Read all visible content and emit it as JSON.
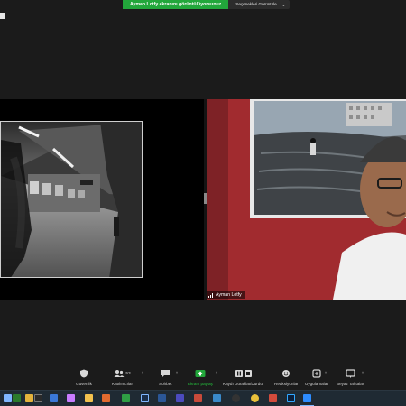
{
  "banner": {
    "share_text": "Ayman Lotfy ekranını görüntülüyorsunuz",
    "view_options_label": "Seçenekleri Görüntüle",
    "caret": "⌄"
  },
  "participant": {
    "name": "Ayman Lotfy"
  },
  "toolbar": {
    "items": [
      {
        "name": "security",
        "label": "Güvenlik",
        "icon": "shield-icon"
      },
      {
        "name": "participants",
        "label": "Katılımcılar",
        "icon": "participants-icon",
        "count": "53"
      },
      {
        "name": "chat",
        "label": "Sohbet",
        "icon": "chat-icon"
      },
      {
        "name": "share-screen",
        "label": "Ekranı paylaş",
        "icon": "share-screen-icon"
      },
      {
        "name": "record",
        "label": "Kaydı Duraklat/Durdur",
        "icon": "pause-stop-icon"
      },
      {
        "name": "reactions",
        "label": "Reaksiyonlar",
        "icon": "reaction-icon"
      },
      {
        "name": "apps",
        "label": "Uygulamalar",
        "icon": "apps-icon"
      },
      {
        "name": "whiteboard",
        "label": "Beyaz Tahtalar",
        "icon": "whiteboard-icon"
      }
    ],
    "chevron": "^"
  },
  "taskbar": {
    "apps": [
      "start-icon",
      "task-view-icon",
      "explorer-icon",
      "terminal-icon",
      "mail-icon",
      "folder-icon",
      "browser-icon",
      "notes-icon",
      "powerpoint-icon",
      "excel-icon",
      "lightroom-icon",
      "word-icon",
      "app-icon",
      "teams-icon",
      "photos-icon",
      "chrome-icon",
      "obs-icon",
      "photoshop-icon",
      "zoom-icon"
    ],
    "colors": {
      "accent": "#22a73b",
      "tile_red": "#9e2a2e",
      "taskbar": "#1f2a33"
    }
  }
}
